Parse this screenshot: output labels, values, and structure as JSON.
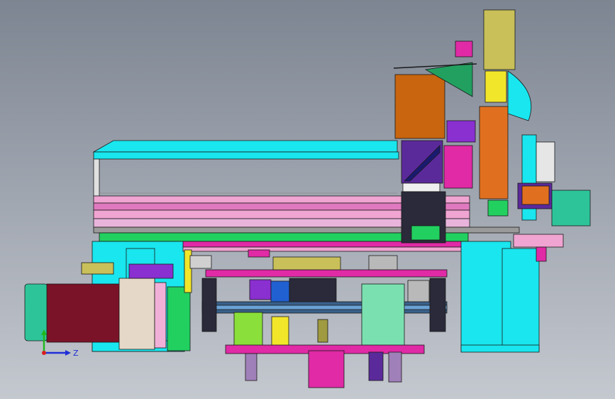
{
  "viewport": {
    "background_top": "#7d8592",
    "background_bottom": "#c4c8cf"
  },
  "axis_triad": {
    "horizontal_label": "Z",
    "horizontal_color": "#1f2fd6",
    "vertical_color": "#1fb81f",
    "origin_color": "#d81f1f"
  },
  "palette": {
    "cyan": "#19e6ee",
    "magenta": "#e02aa6",
    "orange": "#c8650e",
    "purple": "#8a2fd0",
    "violet": "#5b2a9a",
    "green": "#22d060",
    "maroon": "#7a1328",
    "khaki": "#c9c05a",
    "yellow": "#f2e62a",
    "grey": "#b9b9b9",
    "dark": "#2a2a3a",
    "mint": "#7be0b0",
    "pink": "#f0a4d2"
  }
}
